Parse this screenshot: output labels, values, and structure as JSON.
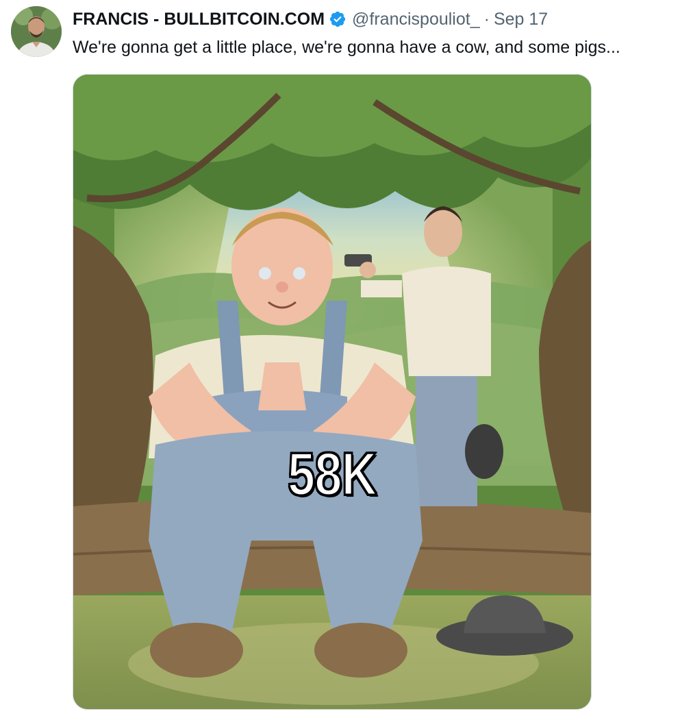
{
  "tweet": {
    "author": {
      "display_name": "FRANCIS - BULLBITCOIN.COM",
      "handle": "@francispouliot_",
      "verified": true
    },
    "separator": "·",
    "date": "Sep 17",
    "text": "We're gonna get a little place, we're gonna have a cow, and some pigs...",
    "media": {
      "caption": "58K"
    }
  },
  "colors": {
    "verified_badge": "#1d9bf0",
    "text_primary": "#0f1419",
    "text_secondary": "#536471"
  }
}
